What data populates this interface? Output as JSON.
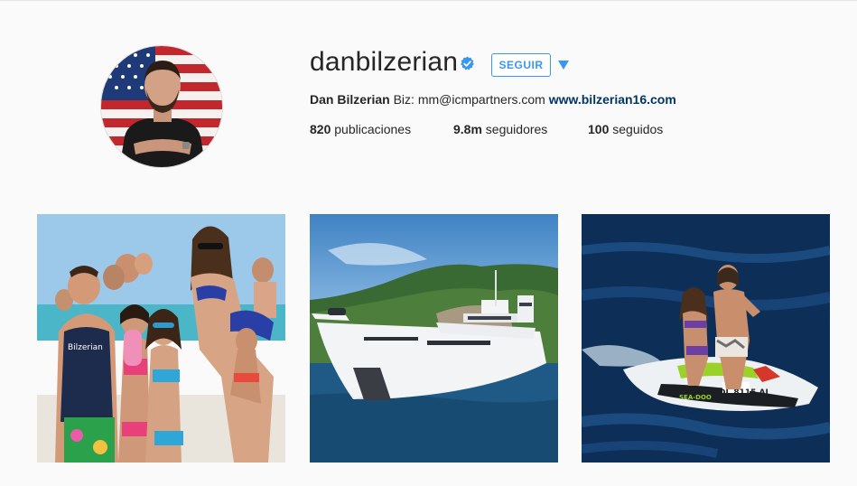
{
  "profile": {
    "username": "danbilzerian",
    "verified": true,
    "follow_label": "SEGUIR",
    "bio": {
      "name": "Dan Bilzerian",
      "text": " Biz: mm@icmpartners.com ",
      "link": "www.bilzerian16.com"
    },
    "stats": {
      "posts_count": "820",
      "posts_label": " publicaciones",
      "followers_count": "9.8m",
      "followers_label": " seguidores",
      "following_count": "100",
      "following_label": " seguidos"
    }
  },
  "posts": [
    {
      "alt": "group photo on boat"
    },
    {
      "alt": "yacht near coastline"
    },
    {
      "alt": "jet ski on water",
      "hull_text": "DL 8115 AJ",
      "brand_text": "SEA-DOO"
    }
  ],
  "colors": {
    "accent": "#3897f0",
    "link": "#003569",
    "verified": "#3897f0"
  }
}
